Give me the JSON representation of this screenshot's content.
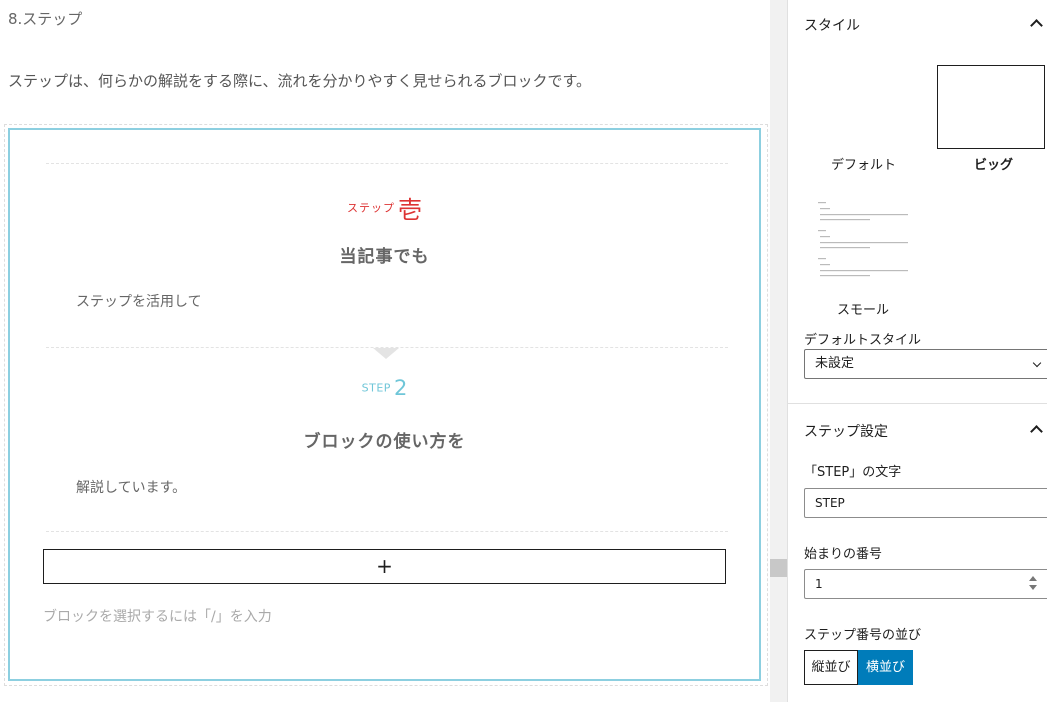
{
  "editor": {
    "heading": "8.ステップ",
    "intro": "ステップは、何らかの解説をする際に、流れを分かりやすく見せられるブロックです。",
    "steps": [
      {
        "label_prefix": "ステップ",
        "number": "壱",
        "title": "当記事でも",
        "body": "ステップを活用して"
      },
      {
        "label_prefix": "STEP",
        "number": "2",
        "title": "ブロックの使い方を",
        "body": "解説しています。"
      }
    ],
    "add_block_label": "+",
    "placeholder": "ブロックを選択するには「/」を入力"
  },
  "sidebar": {
    "style_panel": {
      "title": "スタイル",
      "options": [
        {
          "label": "デフォルト",
          "selected": false
        },
        {
          "label": "ビッグ",
          "selected": true
        },
        {
          "label": "スモール",
          "selected": false
        }
      ],
      "default_style_label": "デフォルトスタイル",
      "default_style_value": "未設定"
    },
    "step_settings": {
      "title": "ステップ設定",
      "step_text_label": "「STEP」の文字",
      "step_text_value": "STEP",
      "start_number_label": "始まりの番号",
      "start_number_value": "1",
      "order_label": "ステップ番号の並び",
      "order_options": [
        "縦並び",
        "横並び"
      ],
      "order_selected": "横並び"
    }
  },
  "colors": {
    "step_border": "#8ccfe0",
    "step1_accent": "#dd3333",
    "step2_accent": "#6fc6d8",
    "primary": "#007cba"
  }
}
